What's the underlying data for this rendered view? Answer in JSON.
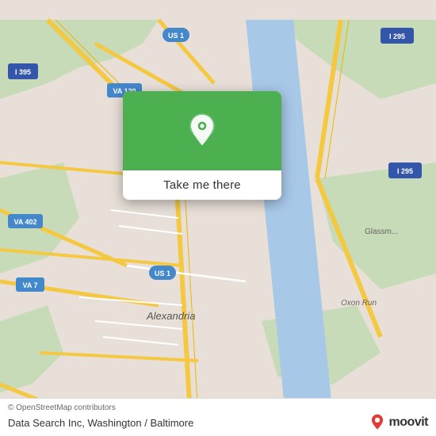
{
  "map": {
    "background_color": "#e8e0d8",
    "popup": {
      "button_label": "Take me there",
      "green_color": "#4CAF50"
    },
    "bottom_bar": {
      "copyright": "© OpenStreetMap contributors",
      "location": "Data Search Inc, Washington / Baltimore",
      "moovit": "moovit"
    },
    "roads": {
      "highway_color": "#f5c842",
      "road_color": "#ffffff",
      "water_color": "#a8c8e8",
      "green_color": "#c8dbb8"
    },
    "labels": {
      "i395": "I 395",
      "va120": "VA 120",
      "us1_top": "US 1",
      "i295_top": "I 295",
      "i295_right": "I 295",
      "va402": "VA 402",
      "va7": "VA 7",
      "us1_bottom": "US 1",
      "alexandria": "Alexandria",
      "glassm": "Glassm...",
      "oxon_run": "Oxon Run"
    }
  }
}
